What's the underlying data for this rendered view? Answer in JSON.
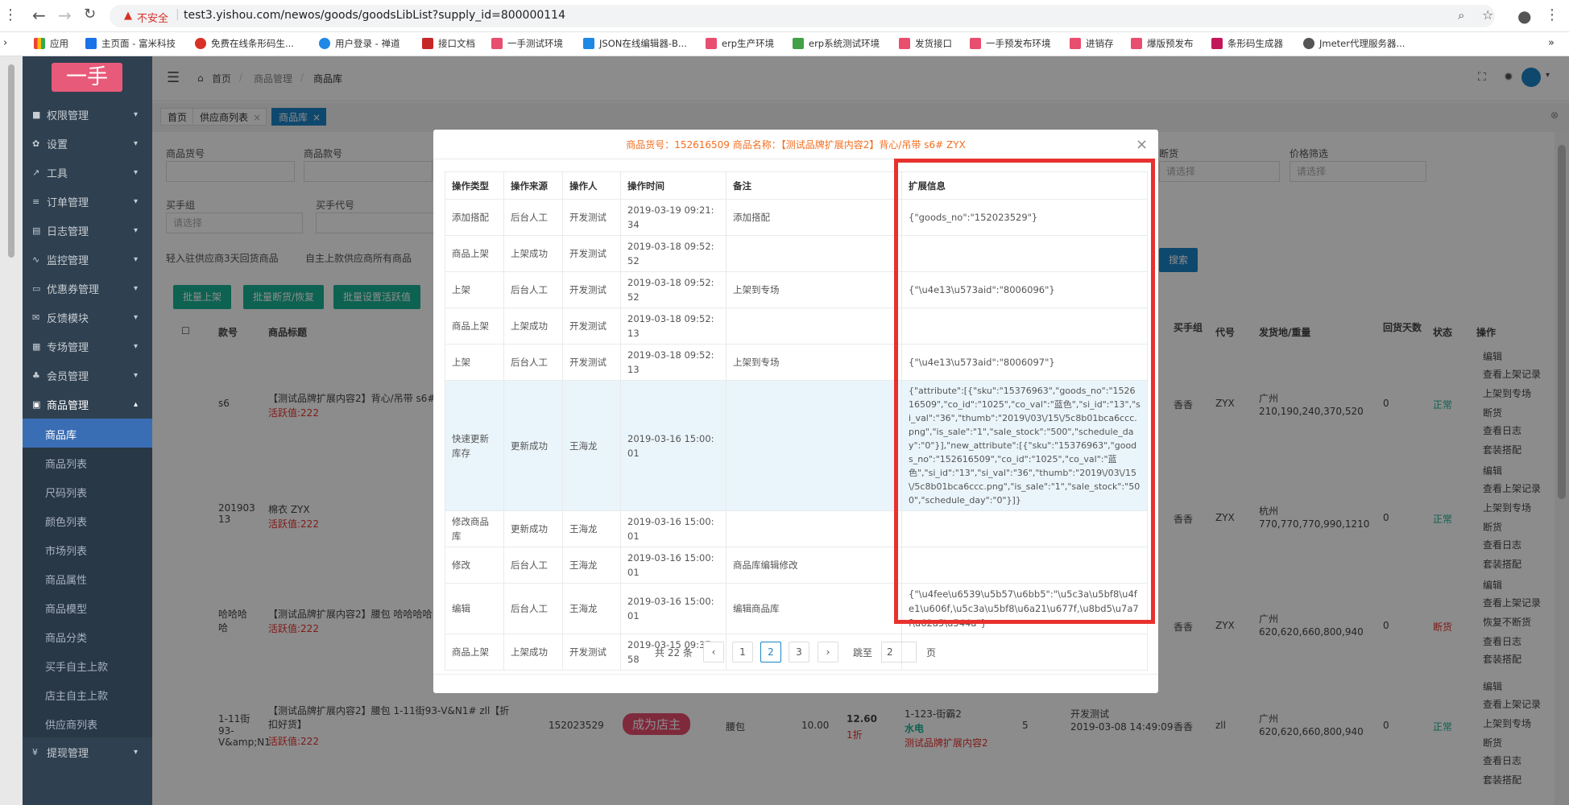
{
  "browser": {
    "security_label": "不安全",
    "url": "test3.yishou.com/newos/goods/goodsLibList?supply_id=800000114",
    "bookmarks": [
      "应用",
      "主页面 - 富米科技",
      "免费在线条形码生...",
      "用户登录 - 禅道",
      "接口文档",
      "一手测试环境",
      "JSON在线编辑器-B...",
      "erp生产环境",
      "erp系统测试环境",
      "发货接口",
      "一手预发布环境",
      "进销存",
      "爆版预发布",
      "条形码生成器",
      "Jmeter代理服务器..."
    ]
  },
  "logo": "一手",
  "sidebar": {
    "items": [
      {
        "label": "权限管理",
        "icon": "lock-icon"
      },
      {
        "label": "设置",
        "icon": "gear-icon"
      },
      {
        "label": "工具",
        "icon": "wrench-icon"
      },
      {
        "label": "订单管理",
        "icon": "list-icon"
      },
      {
        "label": "日志管理",
        "icon": "file-icon"
      },
      {
        "label": "监控管理",
        "icon": "pulse-icon"
      },
      {
        "label": "优惠券管理",
        "icon": "card-icon"
      },
      {
        "label": "反馈模块",
        "icon": "mail-icon"
      },
      {
        "label": "专场管理",
        "icon": "list-icon"
      },
      {
        "label": "会员管理",
        "icon": "users-icon"
      },
      {
        "label": "商品管理",
        "icon": "shop-icon"
      }
    ],
    "sub_items": [
      "商品库",
      "商品列表",
      "尺码列表",
      "颜色列表",
      "市场列表",
      "商品属性",
      "商品模型",
      "商品分类",
      "买手自主上款",
      "店主自主上款",
      "供应商列表"
    ],
    "bottom_item": "提现管理"
  },
  "header": {
    "breadcrumb": [
      "首页",
      "商品管理",
      "商品库"
    ]
  },
  "tabs": [
    "首页",
    "供应商列表",
    "商品库"
  ],
  "filters": {
    "labels": [
      "商品货号",
      "商品款号",
      "买手组",
      "买手代号",
      "断货",
      "价格筛选"
    ],
    "placeholders": [
      "请选择",
      "请选择",
      "请选择"
    ],
    "checkboxes": [
      "轻入驻供应商3天回货商品",
      "自主上款供应商所有商品"
    ],
    "buttons": [
      "批量上架",
      "批量断货/恢复",
      "批量设置活跃值"
    ],
    "search_button": "搜索"
  },
  "bg_table": {
    "headers": [
      "款号",
      "商品标题",
      "买手组",
      "代号",
      "发货地/重量",
      "回货天数",
      "状态",
      "操作"
    ],
    "rows": [
      {
        "no": "s6",
        "title": "【测试品牌扩展内容2】背心/吊带 s6#",
        "active": "活跃值:222",
        "group": "香香",
        "code": "ZYX",
        "place": "广州",
        "weights": "210,190,240,370,520",
        "days": "0",
        "status": "正常",
        "ops": [
          "编辑",
          "查看上架记录",
          "上架到专场",
          "断货",
          "查看日志",
          "套装搭配"
        ]
      },
      {
        "no": "201903 13",
        "title": "棉衣 ZYX",
        "active": "活跃值:222",
        "group": "香香",
        "code": "ZYX",
        "place": "杭州",
        "weights": "770,770,770,990,1210",
        "days": "0",
        "status": "正常",
        "ops": [
          "编辑",
          "查看上架记录",
          "上架到专场",
          "断货",
          "查看日志",
          "套装搭配"
        ]
      },
      {
        "no": "哈哈哈哈",
        "title": "【测试品牌扩展内容2】腰包 哈哈哈哈",
        "active": "活跃值:222",
        "group": "香香",
        "code": "ZYX",
        "place": "广州",
        "weights": "620,620,660,800,940",
        "days": "0",
        "status": "断货",
        "ops": [
          "编辑",
          "查看上架记录",
          "恢复不断货",
          "查看日志",
          "套装搭配"
        ]
      },
      {
        "no": "1-11街93-V&amp;N1",
        "title": "【测试品牌扩展内容2】腰包 1-11街93-V&N1# zll【折扣好货】",
        "active": "活跃值:222",
        "goods_no": "152023529",
        "badge": "成为店主",
        "cat": "腰包",
        "price": "10.00",
        "sale_price": "12.60",
        "discount": "1折",
        "market": "1-123-街霸2",
        "market_sub": "水电",
        "brand": "测试品牌扩展内容2",
        "qty": "5",
        "creator": "开发测试",
        "created": "2019-03-08 14:49:09",
        "group": "香香",
        "code": "zll",
        "place": "广州",
        "weights": "620,620,660,800,940",
        "days": "0",
        "status": "正常",
        "ops": [
          "编辑",
          "查看上架记录",
          "上架到专场",
          "断货",
          "查看日志",
          "套装搭配"
        ]
      }
    ]
  },
  "modal": {
    "title": "商品货号：152616509 商品名称：【测试品牌扩展内容2】背心/吊带 s6# ZYX",
    "headers": [
      "操作类型",
      "操作来源",
      "操作人",
      "操作时间",
      "备注",
      "扩展信息"
    ],
    "rows": [
      {
        "type": "添加搭配",
        "source": "后台人工",
        "user": "开发测试",
        "time": "2019-03-19 09:21:34",
        "note": "添加搭配",
        "ext": "{\"goods_no\":\"152023529\"}"
      },
      {
        "type": "商品上架",
        "source": "上架成功",
        "user": "开发测试",
        "time": "2019-03-18 09:52:52",
        "note": "",
        "ext": ""
      },
      {
        "type": "上架",
        "source": "后台人工",
        "user": "开发测试",
        "time": "2019-03-18 09:52:52",
        "note": "上架到专场",
        "ext": "{\"\\u4e13\\u573aid\":\"8006096\"}"
      },
      {
        "type": "商品上架",
        "source": "上架成功",
        "user": "开发测试",
        "time": "2019-03-18 09:52:13",
        "note": "",
        "ext": ""
      },
      {
        "type": "上架",
        "source": "后台人工",
        "user": "开发测试",
        "time": "2019-03-18 09:52:13",
        "note": "上架到专场",
        "ext": "{\"\\u4e13\\u573aid\":\"8006097\"}"
      },
      {
        "type": "快速更新库存",
        "source": "更新成功",
        "user": "王海龙",
        "time": "2019-03-16 15:00:01",
        "note": "",
        "ext": "{\"attribute\":[{\"sku\":\"15376963\",\"goods_no\":\"152616509\",\"co_id\":\"1025\",\"co_val\":\"蓝色\",\"si_id\":\"13\",\"si_val\":\"36\",\"thumb\":\"2019\\/03\\/15\\/5c8b01bca6ccc.png\",\"is_sale\":\"1\",\"sale_stock\":\"500\",\"schedule_day\":\"0\"}],\"new_attribute\":[{\"sku\":\"15376963\",\"goods_no\":\"152616509\",\"co_id\":\"1025\",\"co_val\":\"蓝色\",\"si_id\":\"13\",\"si_val\":\"36\",\"thumb\":\"2019\\/03\\/15\\/5c8b01bca6ccc.png\",\"is_sale\":\"1\",\"sale_stock\":\"500\",\"schedule_day\":\"0\"}]}"
      },
      {
        "type": "修改商品库",
        "source": "更新成功",
        "user": "王海龙",
        "time": "2019-03-16 15:00:01",
        "note": "",
        "ext": ""
      },
      {
        "type": "修改",
        "source": "后台人工",
        "user": "王海龙",
        "time": "2019-03-16 15:00:01",
        "note": "商品库编辑修改",
        "ext": ""
      },
      {
        "type": "编辑",
        "source": "后台人工",
        "user": "王海龙",
        "time": "2019-03-16 15:00:01",
        "note": "编辑商品库",
        "ext": "{\"\\u4fee\\u6539\\u5b57\\u6bb5\":\"\\u5c3a\\u5bf8\\u4fe1\\u606f,\\u5c3a\\u5bf8\\u6a21\\u677f,\\u8bd5\\u7a7f\\u62a5\\u544a\"}"
      },
      {
        "type": "商品上架",
        "source": "上架成功",
        "user": "开发测试",
        "time": "2019-03-15 09:37:58",
        "note": "",
        "ext": ""
      }
    ],
    "pager": {
      "total": "共 22 条",
      "prev": "‹",
      "pages": [
        "1",
        "2",
        "3"
      ],
      "current": "2",
      "next": "›",
      "jump_label": "跳至",
      "jump_value": "2",
      "page_suffix": "页"
    }
  }
}
